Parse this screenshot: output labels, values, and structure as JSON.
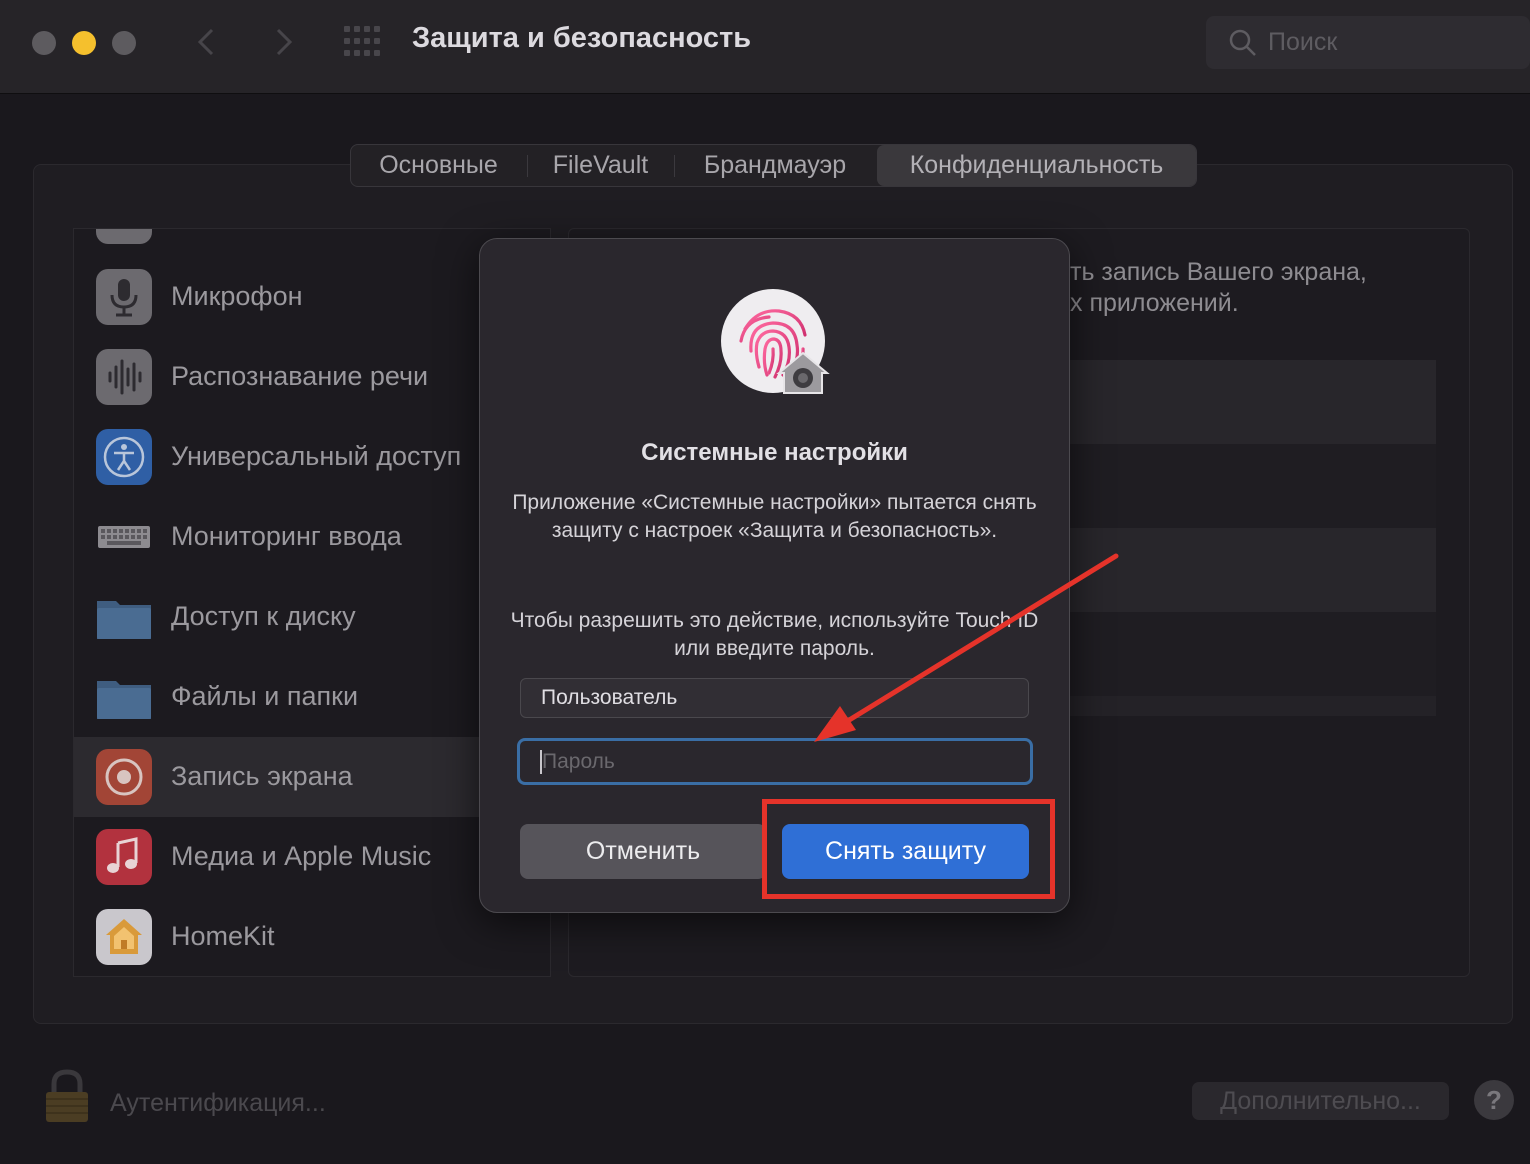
{
  "window": {
    "title": "Защита и безопасность",
    "search_placeholder": "Поиск"
  },
  "tabs": [
    {
      "label": "Основные"
    },
    {
      "label": "FileVault"
    },
    {
      "label": "Брандмауэр"
    },
    {
      "label": "Конфиденциальность",
      "active": true
    }
  ],
  "sidebar": {
    "items": [
      {
        "label": "Микрофон",
        "icon": "microphone-icon"
      },
      {
        "label": "Распознавание речи",
        "icon": "waveform-icon"
      },
      {
        "label": "Универсальный доступ",
        "icon": "accessibility-icon"
      },
      {
        "label": "Мониторинг ввода",
        "icon": "keyboard-icon"
      },
      {
        "label": "Доступ к диску",
        "icon": "folder-icon"
      },
      {
        "label": "Файлы и папки",
        "icon": "folder-icon"
      },
      {
        "label": "Запись экрана",
        "icon": "screen-record-icon",
        "selected": true
      },
      {
        "label": "Медиа и Apple Music",
        "icon": "music-note-icon"
      },
      {
        "label": "HomeKit",
        "icon": "home-icon"
      }
    ]
  },
  "content": {
    "line1": "ть запись Вашего экрана,",
    "line2": "х приложений."
  },
  "footer": {
    "auth_label": "Аутентификация...",
    "more_button": "Дополнительно...",
    "help_button": "?"
  },
  "dialog": {
    "title": "Системные настройки",
    "message": "Приложение «Системные настройки» пытается снять защиту с настроек «Защита и безопасность».",
    "instruction": "Чтобы разрешить это действие, используйте Touch ID или введите пароль.",
    "username_value": "Пользователь",
    "password_placeholder": "Пароль",
    "cancel_button": "Отменить",
    "unlock_button": "Снять защиту",
    "icon": "touch-id-fingerprint-icon"
  },
  "colors": {
    "accent_blue": "#2f6fd6",
    "annotation_red": "#e5332a",
    "yellow_light": "#f5c02d"
  }
}
